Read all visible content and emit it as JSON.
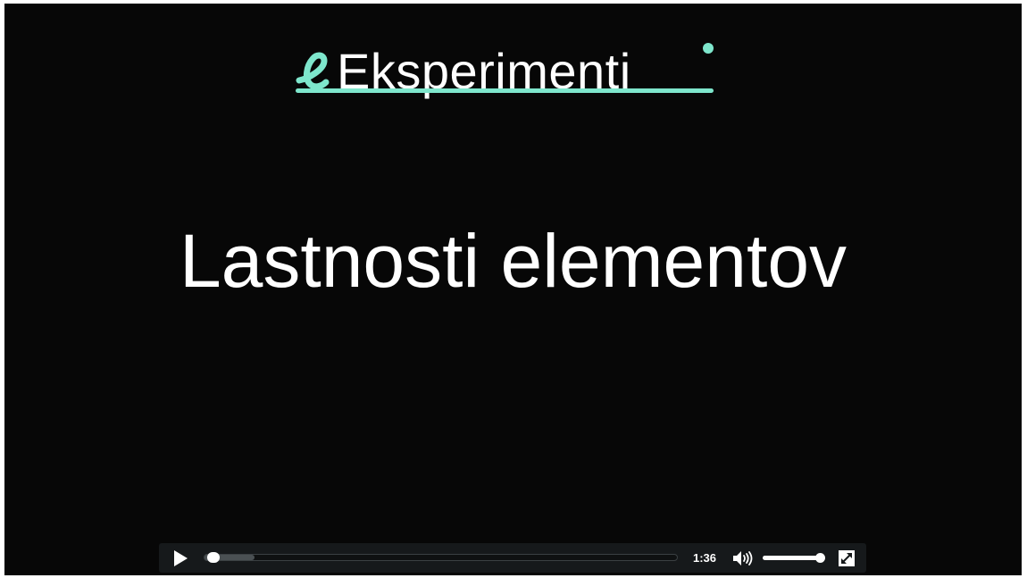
{
  "logo": {
    "text": "Eksperimenti",
    "accent_color": "#7ee6cc"
  },
  "slide": {
    "title": "Lastnosti elementov"
  },
  "controls": {
    "play_icon": "play-icon",
    "progress_fraction": 0.01,
    "buffered_fraction": 0.105,
    "time": "1:36",
    "volume_icon": "speaker-icon",
    "volume_fraction": 0.95,
    "fullscreen_icon": "fullscreen-icon"
  }
}
